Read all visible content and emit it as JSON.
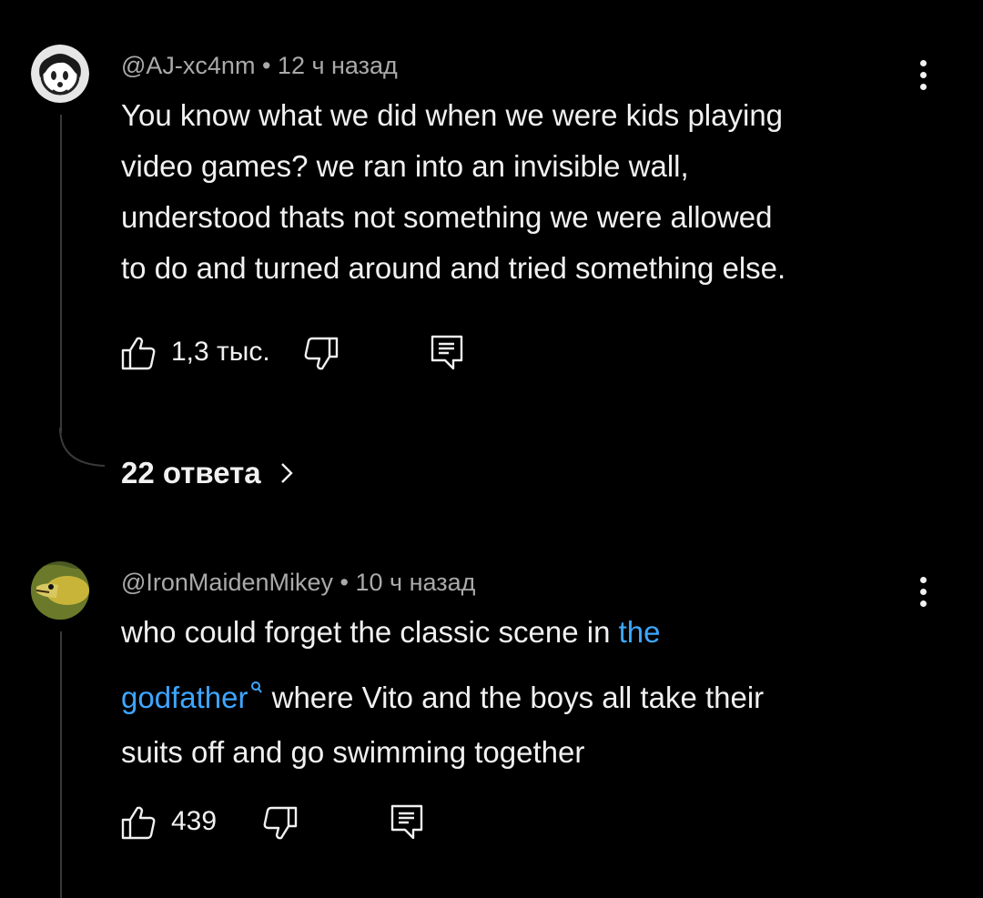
{
  "comments": [
    {
      "author": "@AJ-xc4nm",
      "separator": "•",
      "time": "12 ч назад",
      "lines": [
        "You know what we did when we were kids playing",
        "video games? we ran into an invisible wall,",
        "understood thats not something we were allowed",
        "to do and turned around and tried something else."
      ],
      "likes": "1,3 тыс.",
      "replies_label": "22 ответа"
    },
    {
      "author": "@IronMaidenMikey",
      "separator": "•",
      "time": "10 ч назад",
      "text_before_link": "who could forget the classic scene in ",
      "link_part1": "the",
      "link_part2": "godfather",
      "text_after_link": " where Vito and the boys all take their",
      "line3": "suits off and go swimming together",
      "likes": "439"
    }
  ],
  "colors": {
    "background": "#000000",
    "text": "#f1f1f1",
    "meta": "#aaaaaa",
    "link": "#3ea6ff",
    "thread_line": "#3a3a3a"
  }
}
